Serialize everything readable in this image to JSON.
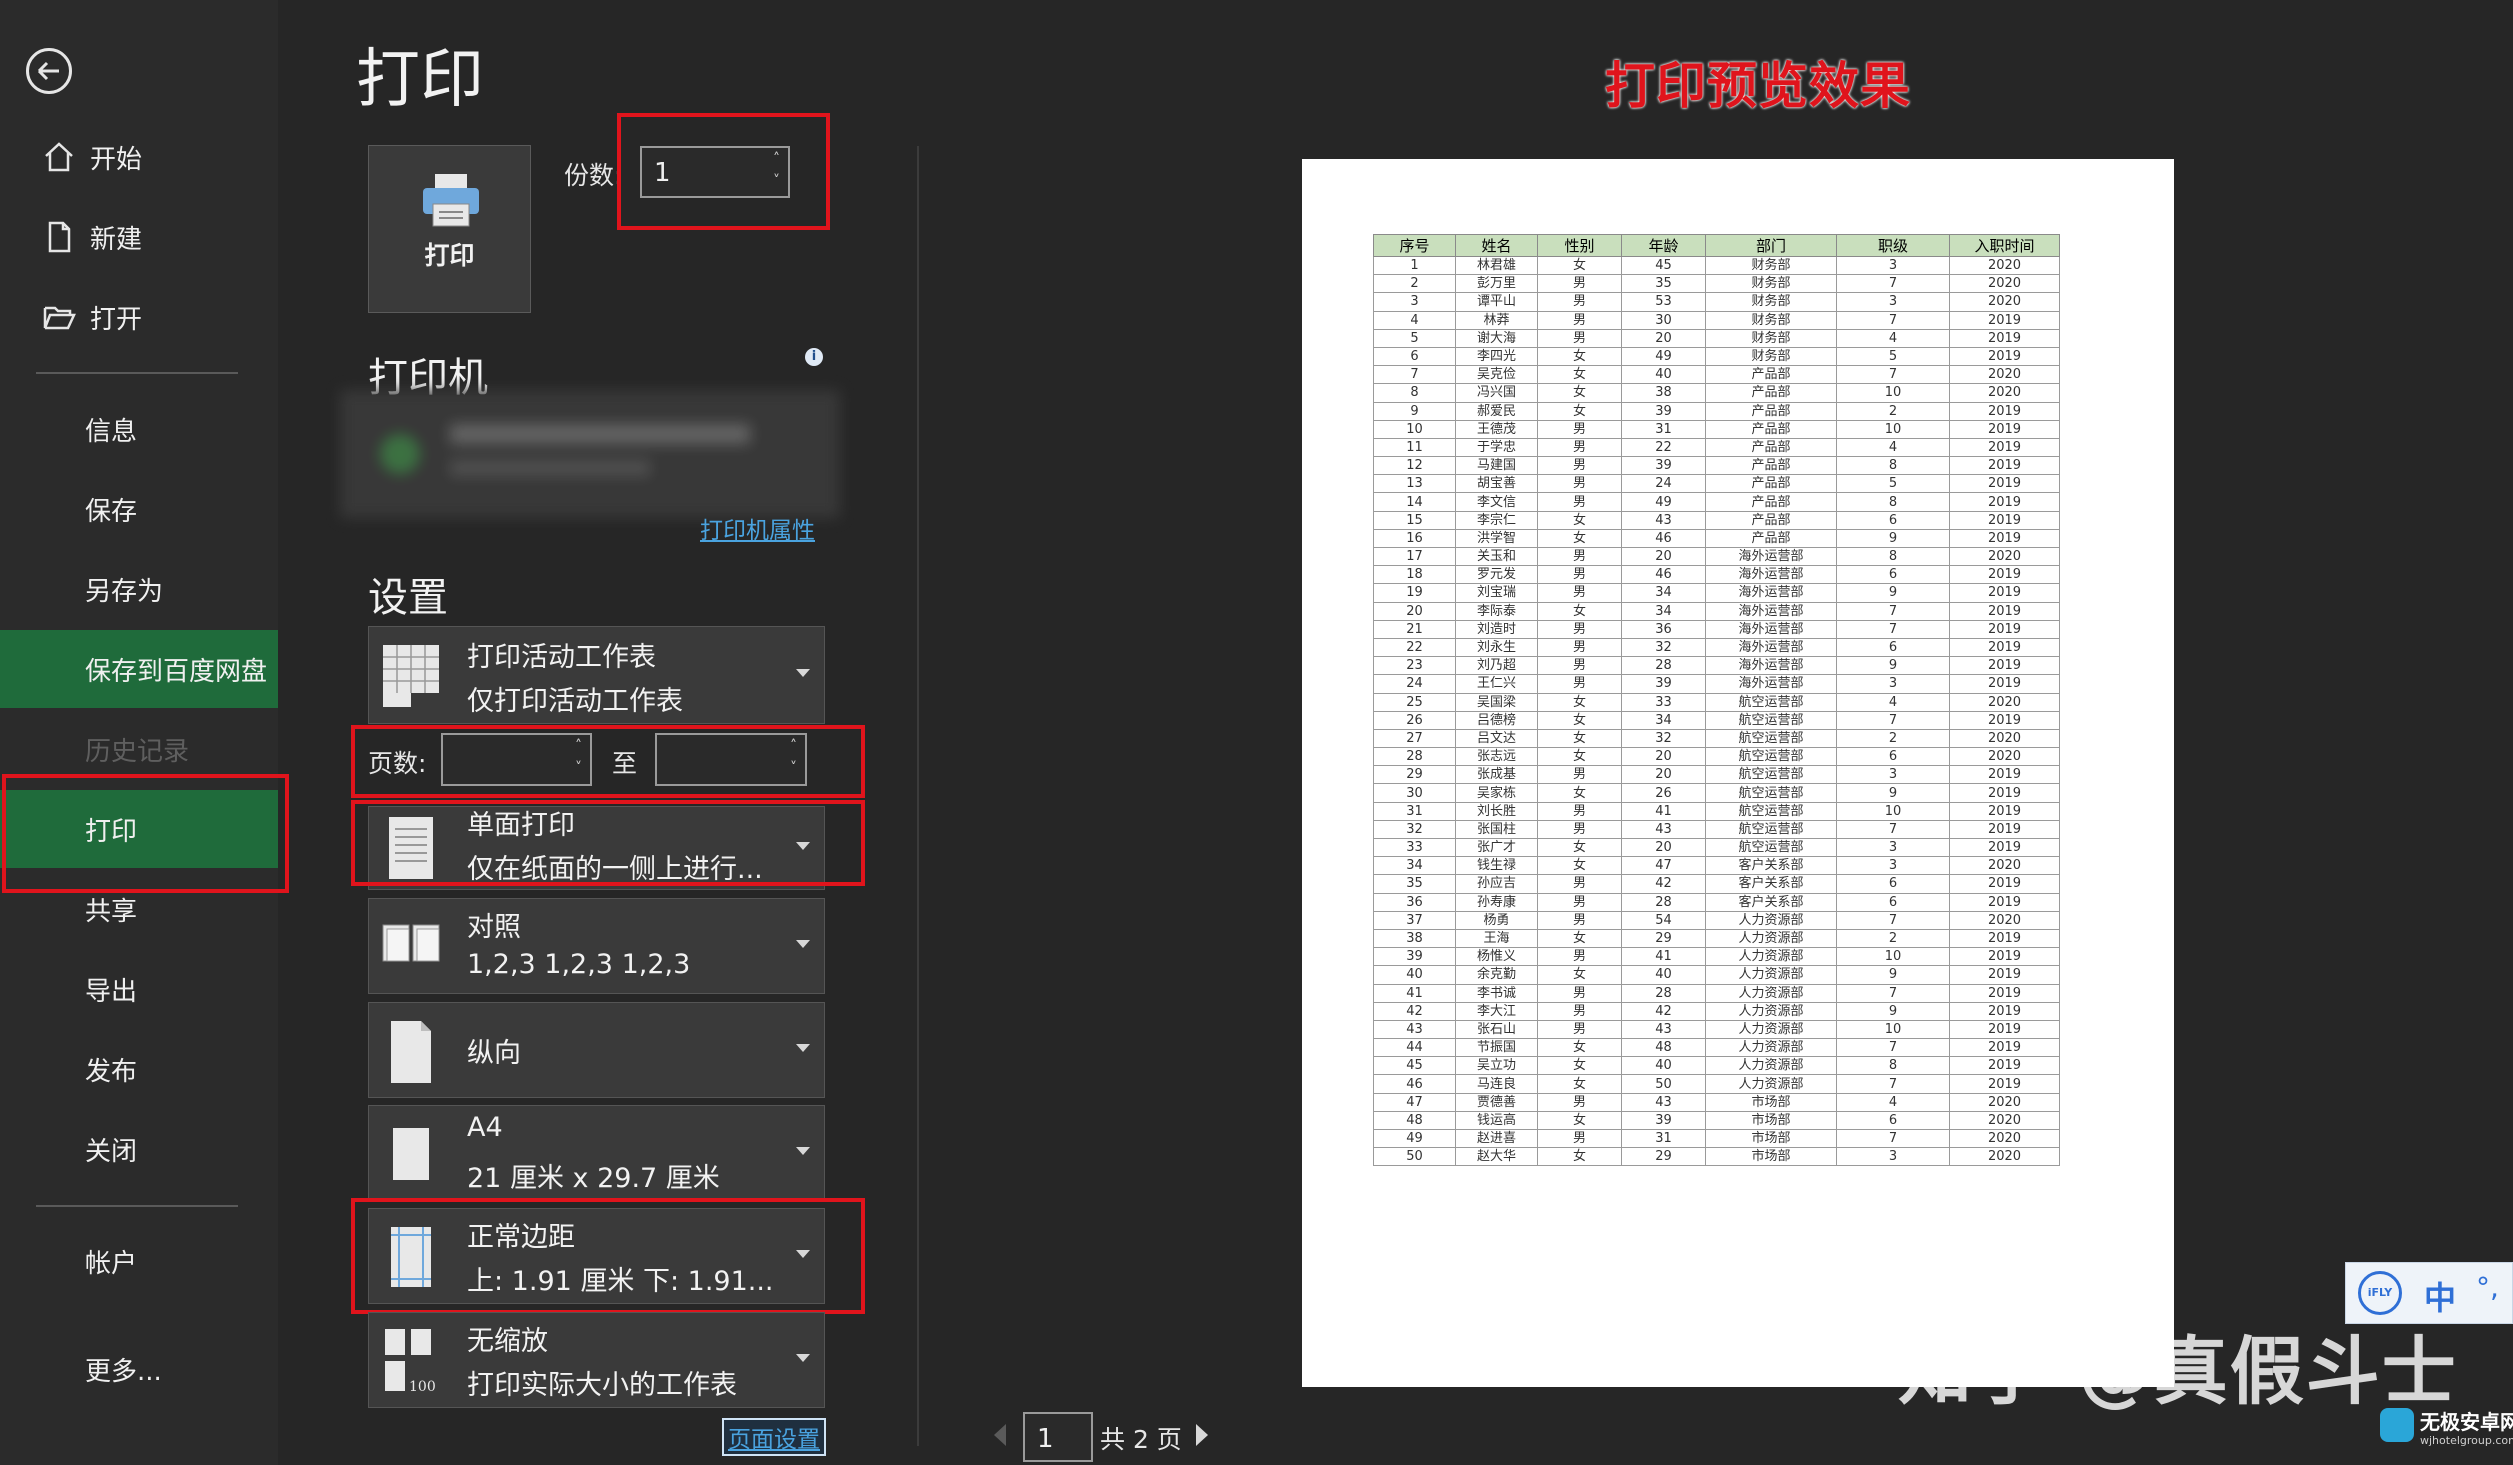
{
  "sidebar": {
    "items": [
      {
        "label": "开始",
        "icon": "home-icon"
      },
      {
        "label": "新建",
        "icon": "new-document-icon"
      },
      {
        "label": "打开",
        "icon": "open-folder-icon"
      },
      {
        "label": "信息"
      },
      {
        "label": "保存"
      },
      {
        "label": "另存为"
      },
      {
        "label": "保存到百度网盘"
      },
      {
        "label": "历史记录"
      },
      {
        "label": "打印"
      },
      {
        "label": "共享"
      },
      {
        "label": "导出"
      },
      {
        "label": "发布"
      },
      {
        "label": "关闭"
      },
      {
        "label": "帐户"
      },
      {
        "label": "更多..."
      }
    ],
    "active": "打印",
    "active_color": "#1f6b3b"
  },
  "print": {
    "title": "打印",
    "button_label": "打印",
    "copies_label": "份数:",
    "copies_value": "1",
    "printer_title": "打印机",
    "printer_props_link": "打印机属性",
    "settings_title": "设置",
    "pages_label": "页数:",
    "pages_to": "至",
    "page_setup_link": "页面设置",
    "options": [
      {
        "line1": "打印活动工作表",
        "line2": "仅打印活动工作表"
      },
      {
        "line1": "单面打印",
        "line2": "仅在纸面的一侧上进行..."
      },
      {
        "line1": "对照",
        "line2": "1,2,3    1,2,3    1,2,3"
      },
      {
        "line1": "纵向",
        "line2": ""
      },
      {
        "line1": "A4",
        "line2": "21 厘米 x 29.7 厘米"
      },
      {
        "line1": "正常边距",
        "line2": "上: 1.91 厘米 下: 1.91..."
      },
      {
        "line1": "无缩放",
        "line2": "打印实际大小的工作表"
      }
    ]
  },
  "preview": {
    "caption": "打印预览效果",
    "current_page": "1",
    "total_pages": "共 2 页",
    "watermark": "知乎 @真假斗士",
    "table": {
      "headers": [
        "序号",
        "姓名",
        "性别",
        "年龄",
        "部门",
        "职级",
        "入职时间"
      ],
      "rows": [
        [
          "1",
          "林君雄",
          "女",
          "45",
          "财务部",
          "3",
          "2020"
        ],
        [
          "2",
          "彭万里",
          "男",
          "35",
          "财务部",
          "7",
          "2020"
        ],
        [
          "3",
          "谭平山",
          "男",
          "53",
          "财务部",
          "3",
          "2020"
        ],
        [
          "4",
          "林莽",
          "男",
          "30",
          "财务部",
          "7",
          "2019"
        ],
        [
          "5",
          "谢大海",
          "男",
          "20",
          "财务部",
          "4",
          "2019"
        ],
        [
          "6",
          "李四光",
          "女",
          "49",
          "财务部",
          "5",
          "2019"
        ],
        [
          "7",
          "吴克俭",
          "女",
          "40",
          "产品部",
          "7",
          "2020"
        ],
        [
          "8",
          "冯兴国",
          "女",
          "38",
          "产品部",
          "10",
          "2020"
        ],
        [
          "9",
          "郝爱民",
          "女",
          "39",
          "产品部",
          "2",
          "2019"
        ],
        [
          "10",
          "王德茂",
          "男",
          "31",
          "产品部",
          "10",
          "2019"
        ],
        [
          "11",
          "于学忠",
          "男",
          "22",
          "产品部",
          "4",
          "2019"
        ],
        [
          "12",
          "马建国",
          "男",
          "39",
          "产品部",
          "8",
          "2019"
        ],
        [
          "13",
          "胡宝善",
          "男",
          "24",
          "产品部",
          "5",
          "2019"
        ],
        [
          "14",
          "李文信",
          "男",
          "49",
          "产品部",
          "8",
          "2019"
        ],
        [
          "15",
          "李宗仁",
          "女",
          "43",
          "产品部",
          "6",
          "2019"
        ],
        [
          "16",
          "洪学智",
          "女",
          "46",
          "产品部",
          "9",
          "2019"
        ],
        [
          "17",
          "关玉和",
          "男",
          "20",
          "海外运营部",
          "8",
          "2020"
        ],
        [
          "18",
          "罗元发",
          "男",
          "46",
          "海外运营部",
          "6",
          "2019"
        ],
        [
          "19",
          "刘宝瑞",
          "男",
          "34",
          "海外运营部",
          "9",
          "2019"
        ],
        [
          "20",
          "李际泰",
          "女",
          "34",
          "海外运营部",
          "7",
          "2019"
        ],
        [
          "21",
          "刘造时",
          "男",
          "36",
          "海外运营部",
          "7",
          "2019"
        ],
        [
          "22",
          "刘永生",
          "男",
          "32",
          "海外运营部",
          "6",
          "2019"
        ],
        [
          "23",
          "刘乃超",
          "男",
          "28",
          "海外运营部",
          "9",
          "2019"
        ],
        [
          "24",
          "王仁兴",
          "男",
          "39",
          "海外运营部",
          "3",
          "2019"
        ],
        [
          "25",
          "吴国梁",
          "女",
          "33",
          "航空运营部",
          "4",
          "2020"
        ],
        [
          "26",
          "吕德榜",
          "女",
          "34",
          "航空运营部",
          "7",
          "2019"
        ],
        [
          "27",
          "吕文达",
          "女",
          "32",
          "航空运营部",
          "2",
          "2020"
        ],
        [
          "28",
          "张志远",
          "女",
          "20",
          "航空运营部",
          "6",
          "2020"
        ],
        [
          "29",
          "张成基",
          "男",
          "20",
          "航空运营部",
          "3",
          "2019"
        ],
        [
          "30",
          "吴家栋",
          "女",
          "26",
          "航空运营部",
          "9",
          "2019"
        ],
        [
          "31",
          "刘长胜",
          "男",
          "41",
          "航空运营部",
          "10",
          "2019"
        ],
        [
          "32",
          "张国柱",
          "男",
          "43",
          "航空运营部",
          "7",
          "2019"
        ],
        [
          "33",
          "张广才",
          "女",
          "20",
          "航空运营部",
          "3",
          "2019"
        ],
        [
          "34",
          "钱生禄",
          "女",
          "47",
          "客户关系部",
          "3",
          "2020"
        ],
        [
          "35",
          "孙应吉",
          "男",
          "42",
          "客户关系部",
          "6",
          "2019"
        ],
        [
          "36",
          "孙寿康",
          "男",
          "28",
          "客户关系部",
          "6",
          "2019"
        ],
        [
          "37",
          "杨勇",
          "男",
          "54",
          "人力资源部",
          "7",
          "2020"
        ],
        [
          "38",
          "王海",
          "女",
          "29",
          "人力资源部",
          "2",
          "2019"
        ],
        [
          "39",
          "杨惟义",
          "男",
          "41",
          "人力资源部",
          "10",
          "2019"
        ],
        [
          "40",
          "余克勤",
          "女",
          "40",
          "人力资源部",
          "9",
          "2019"
        ],
        [
          "41",
          "李书诚",
          "男",
          "28",
          "人力资源部",
          "7",
          "2019"
        ],
        [
          "42",
          "李大江",
          "男",
          "42",
          "人力资源部",
          "9",
          "2019"
        ],
        [
          "43",
          "张石山",
          "男",
          "43",
          "人力资源部",
          "10",
          "2019"
        ],
        [
          "44",
          "节振国",
          "女",
          "48",
          "人力资源部",
          "7",
          "2019"
        ],
        [
          "45",
          "吴立功",
          "女",
          "40",
          "人力资源部",
          "8",
          "2019"
        ],
        [
          "46",
          "马连良",
          "女",
          "50",
          "人力资源部",
          "7",
          "2019"
        ],
        [
          "47",
          "贾德善",
          "男",
          "43",
          "市场部",
          "4",
          "2020"
        ],
        [
          "48",
          "钱运高",
          "女",
          "39",
          "市场部",
          "6",
          "2020"
        ],
        [
          "49",
          "赵进喜",
          "男",
          "31",
          "市场部",
          "7",
          "2020"
        ],
        [
          "50",
          "赵大华",
          "女",
          "29",
          "市场部",
          "3",
          "2020"
        ]
      ]
    }
  },
  "ime": {
    "lang": "中"
  },
  "brand": {
    "name": "无极安卓网",
    "url": "wjhotelgroup.com"
  },
  "colors": {
    "highlight": "#e0141c",
    "header_fill": "#c9dfbd",
    "link": "#4aa3df"
  }
}
